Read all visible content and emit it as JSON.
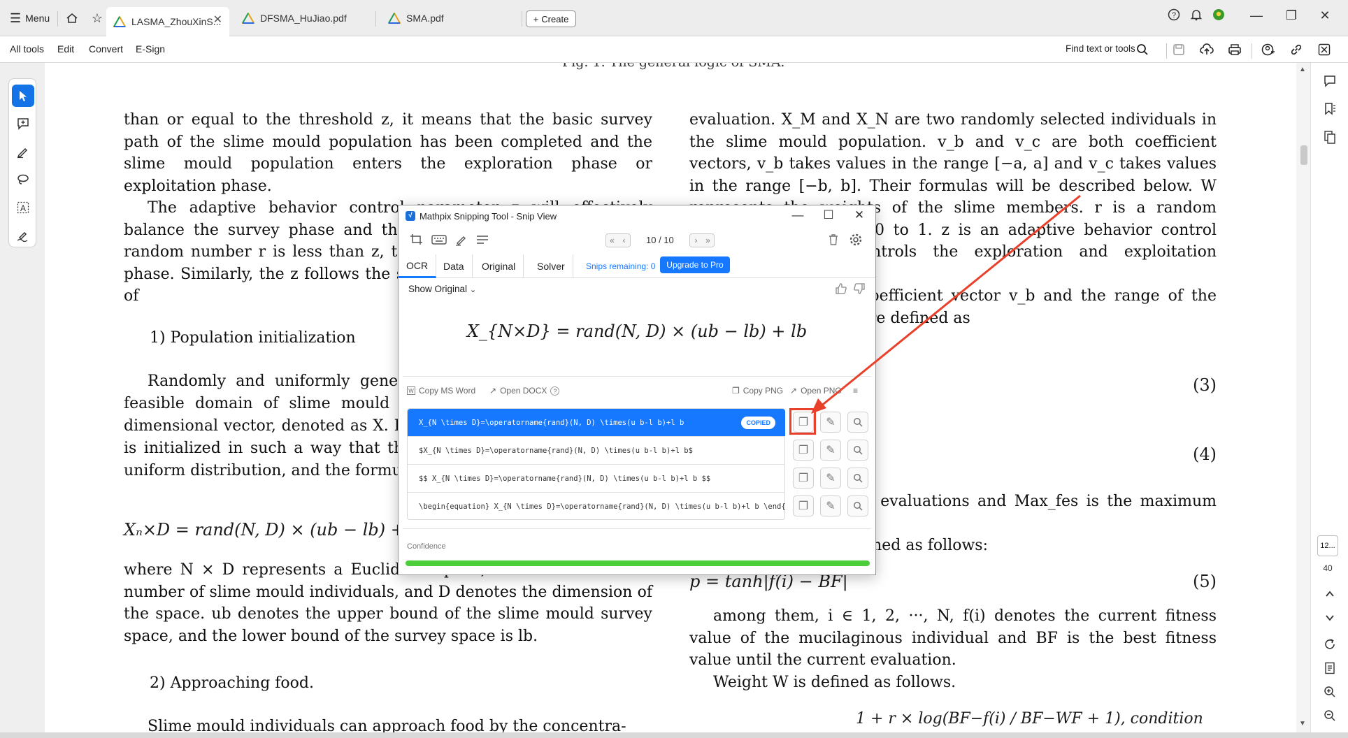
{
  "tabbar": {
    "menu_label": "Menu",
    "tabs": [
      {
        "label": "LASMA_ZhouXinS..."
      },
      {
        "label": "DFSMA_HuJiao.pdf"
      },
      {
        "label": "SMA.pdf"
      }
    ],
    "create_label": "Create"
  },
  "toolbar": {
    "menu": [
      "All tools",
      "Edit",
      "Convert",
      "E-Sign"
    ],
    "find_label": "Find text or tools"
  },
  "document": {
    "top_cut": "Fig. 1.  The general logic of SMA.",
    "left": {
      "p1": "than or equal to the threshold z, it means that the basic survey path of the slime mould population has been completed and the slime mould population enters the exploration phase or exploitation phase.",
      "p2": "The adaptive behavior control parameter z will effectively balance the survey phase and the exploration phase. When the random number r is less than z, the slime mould is in the survey phase. Similarly, the z follows the same pattern. The SMA consists of",
      "h1": "1)  Population initialization",
      "p3": "Randomly and uniformly generate the population within the feasible domain of slime mould m. Each slime mould is a D-dimensional vector, denoted as X. In the original SMA algorithm, it is initialized in such a way that the slime mould conforms to the uniform distribution, and the formula is shown below:",
      "eq": "Xₙ×D = rand(N, D) × (ub − lb) + lb",
      "p4": "where N × D represents a Euclidean space, N denotes the total number of slime mould individuals, and D denotes the dimension of the space. ub denotes the upper bound of the slime mould survey space, and the lower bound of the survey space is lb.",
      "h2": "2)  Approaching food.",
      "p5": "Slime mould individuals can approach food by the concentra-"
    },
    "right": {
      "p1": "evaluation. X_M and X_N are two randomly selected individuals in the slime mould population. v_b and v_c are both coefficient vectors, v_b takes values in the range [−a, a] and v_c takes values in the range [−b, b]. Their formulas will be described below. W represents the weights of the slime members. r is a random number ranging from 0 to 1. z is an adaptive behavior control parameter, which controls the exploration and exploitation behavior",
      "p2": "The range of the coefficient vector v_b and the range of the coefficient vector v_c are defined as",
      "eq3_num": "(3)",
      "eq4_num": "(4)",
      "p3": "the current number of evaluations and Max_fes is the maximum evaluations.",
      "p4": "The parameter p is defined as follows:",
      "eq5": "p = tanh|f(i) − BF|",
      "eq5_num": "(5)",
      "p5": "among them, i ∈ 1, 2, ···, N, f(i) denotes the current fitness value of the mucilaginous individual and BF is the best fitness value until the current evaluation.",
      "p6": "Weight W is defined as follows.",
      "eq6": "1 + r × log(BF−f(i) / BF−WF + 1), condition"
    }
  },
  "right_rail": {
    "page_current": "12...",
    "page_total": "40"
  },
  "mathpix": {
    "title": "Mathpix Snipping Tool - Snip View",
    "counter": "10 / 10",
    "tabs": [
      "OCR",
      "Data",
      "Original",
      "Solver"
    ],
    "snips_remaining": "Snips remaining: 0",
    "upgrade_label": "Upgrade to Pro",
    "show_original": "Show Original",
    "preview_formula": "X_{N×D} = rand(N, D) × (ub − lb) + lb",
    "copy_ms_word": "Copy MS Word",
    "open_docx": "Open DOCX",
    "copy_png": "Copy PNG",
    "open_png": "Open PNG",
    "results": [
      "X_{N \\times D}=\\operatorname{rand}(N, D) \\times(u b-l b)+l b",
      "$X_{N \\times D}=\\operatorname{rand}(N, D) \\times(u b-l b)+l b$",
      "$$  X_{N \\times D}=\\operatorname{rand}(N, D) \\times(u b-l b)+l b  $$",
      "\\begin{equation}  X_{N \\times D}=\\operatorname{rand}(N, D) \\times(u b-l b)+l b  \\end{"
    ],
    "copied_badge": "COPIED",
    "confidence_label": "Confidence",
    "confidence": 1.0
  },
  "colors": {
    "accent": "#1677ff",
    "annotation": "#e8402a",
    "confidence": "#4ccd3a"
  }
}
